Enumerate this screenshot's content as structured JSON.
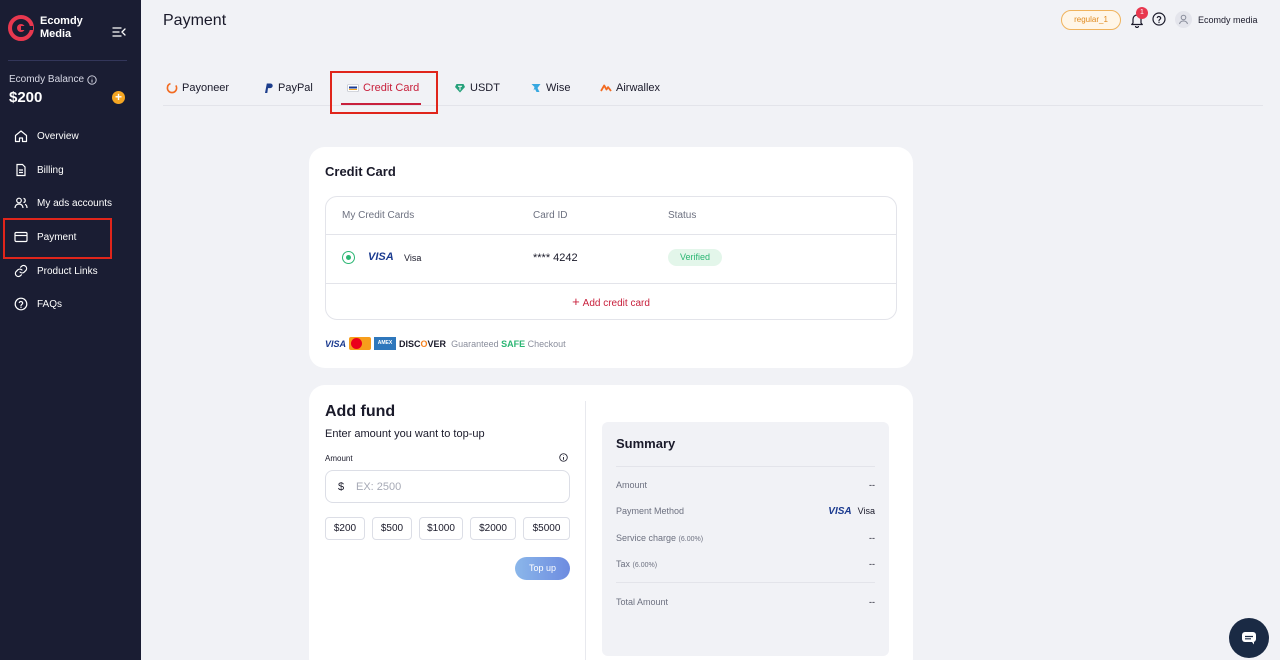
{
  "sidebar": {
    "brand_name": "Ecomdy Media",
    "balance_label": "Ecomdy Balance",
    "balance_value": "$200",
    "add_symbol": "+",
    "items": [
      {
        "label": "Overview",
        "icon": "home-icon"
      },
      {
        "label": "Billing",
        "icon": "document-icon"
      },
      {
        "label": "My ads accounts",
        "icon": "users-icon"
      },
      {
        "label": "Payment",
        "icon": "credit-card-icon"
      },
      {
        "label": "Product Links",
        "icon": "link-icon"
      },
      {
        "label": "FAQs",
        "icon": "help-circle-icon"
      }
    ]
  },
  "header": {
    "title": "Payment",
    "tier": "regular_1",
    "notification_count": "1",
    "user_name": "Ecomdy media"
  },
  "tabs": [
    {
      "label": "Payoneer",
      "icon": "payoneer-icon"
    },
    {
      "label": "PayPal",
      "icon": "paypal-icon"
    },
    {
      "label": "Credit Card",
      "icon": "credit-card-icon",
      "active": true
    },
    {
      "label": "USDT",
      "icon": "usdt-icon"
    },
    {
      "label": "Wise",
      "icon": "wise-icon"
    },
    {
      "label": "Airwallex",
      "icon": "airwallex-icon"
    }
  ],
  "credit_card": {
    "title": "Credit Card",
    "columns": [
      "My Credit Cards",
      "Card ID",
      "Status"
    ],
    "cards": [
      {
        "brand": "VISA",
        "type": "Visa",
        "card_id": "**** 4242",
        "status": "Verified",
        "selected": true
      }
    ],
    "add_label": "Add credit card",
    "badges": {
      "visa": "VISA",
      "amex": "AMEX",
      "discover": "DISC",
      "discover_o": "O",
      "discover_end": "VER"
    },
    "safe_prefix": "Guaranteed ",
    "safe_word": "SAFE",
    "safe_suffix": " Checkout"
  },
  "add_fund": {
    "title": "Add fund",
    "subtitle": "Enter amount you want to top-up",
    "amount_label": "Amount",
    "currency": "$",
    "placeholder": "EX: 2500",
    "quick_amounts": [
      "$200",
      "$500",
      "$1000",
      "$2000",
      "$5000"
    ],
    "topup_label": "Top up"
  },
  "summary": {
    "title": "Summary",
    "rows": [
      {
        "label": "Amount",
        "note": "",
        "value": "--"
      },
      {
        "label": "Payment Method",
        "note": "",
        "brand": "VISA",
        "value": "Visa"
      },
      {
        "label": "Service charge",
        "note": "(6.00%)",
        "value": "--"
      },
      {
        "label": "Tax",
        "note": "(6.00%)",
        "value": "--"
      },
      {
        "label": "Total Amount",
        "note": "",
        "value": "--"
      }
    ]
  },
  "colors": {
    "sidebar_bg": "#1a1d33",
    "accent": "#c8203c",
    "success": "#2bb673",
    "highlight_box": "#e0251b"
  }
}
